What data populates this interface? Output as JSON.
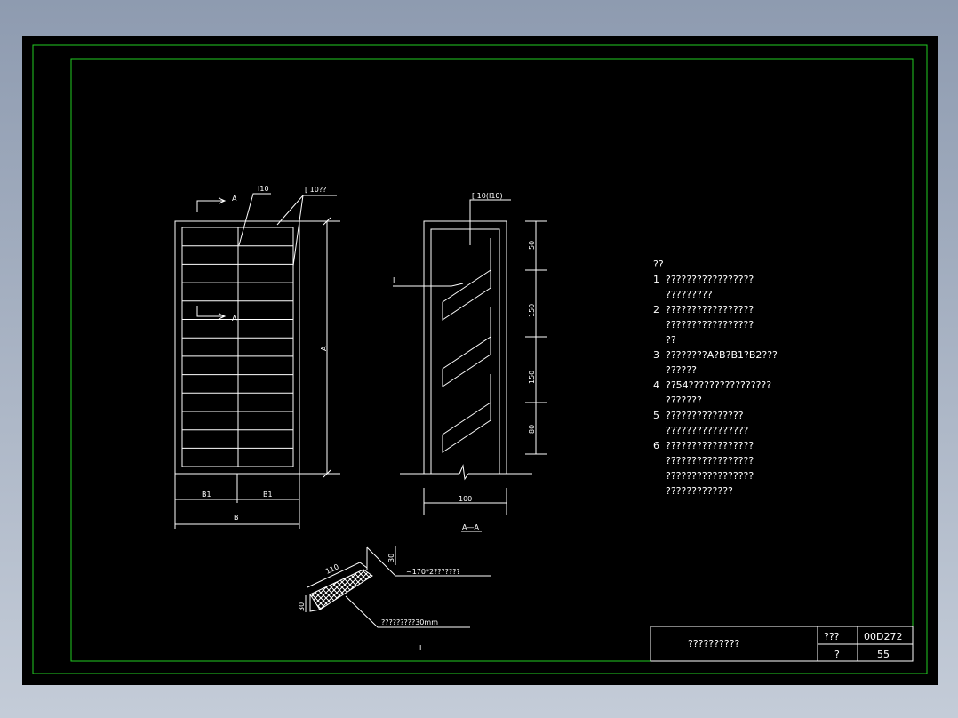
{
  "section_arrow_label": "A",
  "front_view": {
    "label_i10": "I10",
    "label_channel": "[ 10??",
    "dim_height": "A",
    "dim_b1_left": "B1",
    "dim_b1_right": "B1",
    "dim_b": "B"
  },
  "section_view": {
    "label_channel": "[ 10(I10)",
    "label_i": "I",
    "dims": [
      "50",
      "150",
      "150",
      "80"
    ],
    "dim_width": "100",
    "title": "A—A"
  },
  "detail": {
    "dim_110": "110",
    "dim_30_top": "30",
    "dim_30_left": "30",
    "note_plate": "~170*2???????",
    "note_depth": "?????????30mm",
    "mark": "I"
  },
  "notes": {
    "heading": "??",
    "lines": [
      "1  ?????????????????",
      "    ?????????",
      "2  ?????????????????",
      "    ?????????????????",
      "    ??",
      "3  ????????A?B?B1?B2???",
      "    ??????",
      "4  ??54????????????????",
      "    ???????",
      "5  ???????????????",
      "    ????????????????",
      "6  ?????????????????",
      "    ?????????????????",
      "    ?????????????????",
      "    ?????????????"
    ]
  },
  "title_block": {
    "drawing_name": "??????????",
    "label_atlas": "???",
    "atlas_no": "00D272",
    "label_page": "?",
    "page_no": "55"
  },
  "colors": {
    "background": "#000000",
    "frame": "#22cc22",
    "line": "#ffffff"
  }
}
